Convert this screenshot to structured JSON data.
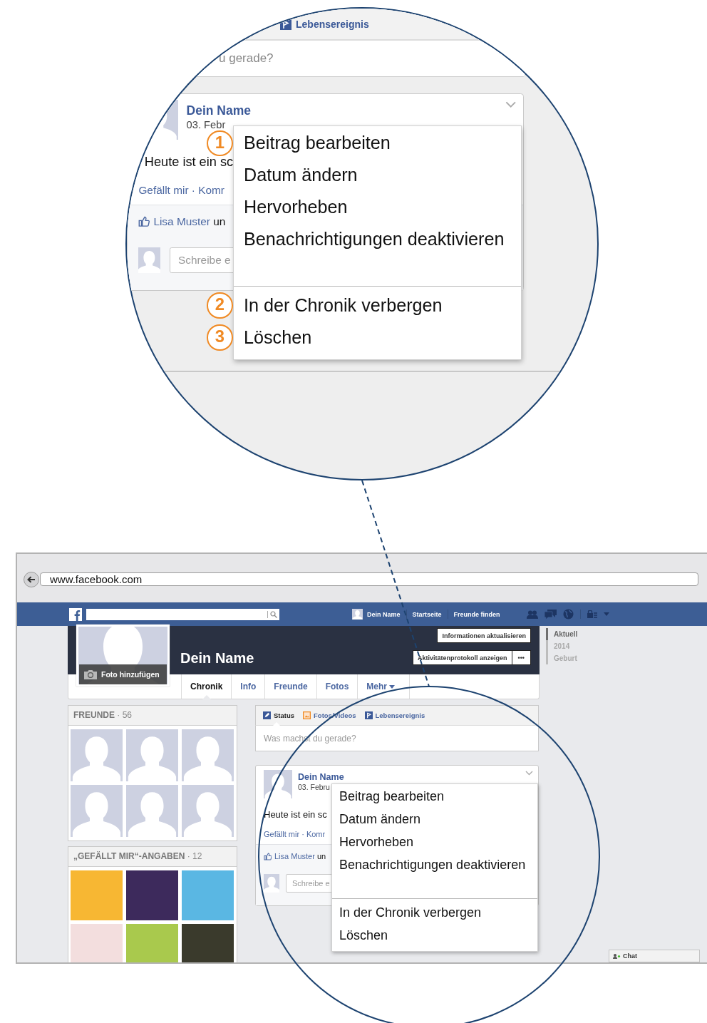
{
  "magnifier": {
    "composer": {
      "tab": "Lebensereignis",
      "placeholder": "u gerade?"
    },
    "post": {
      "author": "Dein Name",
      "date": "03. Febr",
      "text": "Heute ist ein sc",
      "actions": "Gefällt mir · Komr",
      "like_name": "Lisa Muster",
      "like_rest": "un",
      "comment_placeholder": "Schreibe e"
    },
    "menu": {
      "groups": [
        {
          "items": [
            {
              "label": "Beitrag bearbeiten",
              "number": "1"
            },
            {
              "label": "Datum ändern"
            },
            {
              "label": "Hervorheben"
            },
            {
              "label": "Benachrichtigungen deaktivieren"
            }
          ]
        },
        {
          "items": [
            {
              "label": "In der Chronik verbergen",
              "number": "2"
            },
            {
              "label": "Löschen",
              "number": "3"
            }
          ]
        }
      ]
    }
  },
  "browser": {
    "url": "www.facebook.com"
  },
  "topbar": {
    "user": "Dein Name",
    "links": [
      "Startseite",
      "Freunde finden"
    ]
  },
  "profile": {
    "name": "Dein Name",
    "add_photo": "Foto hinzufügen",
    "update_button": "Informationen aktualisieren",
    "activity_button": "Aktivitätenprotokoll anzeigen",
    "more_button": "•••",
    "tabs": [
      {
        "label": "Chronik",
        "selected": true
      },
      {
        "label": "Info",
        "selected": false
      },
      {
        "label": "Freunde",
        "selected": false
      },
      {
        "label": "Fotos",
        "selected": false
      },
      {
        "label": "Mehr",
        "selected": false,
        "dropdown": true
      }
    ]
  },
  "timeline": [
    {
      "label": "Aktuell",
      "selected": true
    },
    {
      "label": "2014",
      "selected": false
    },
    {
      "label": "Geburt",
      "selected": false
    }
  ],
  "friends": {
    "title": "**FREUNDE** · 56"
  },
  "likes": {
    "title": "**„GEFÄLLT MIR“-ANGABEN** · 12"
  },
  "composer": {
    "tabs": [
      {
        "label": "Status",
        "selected": true,
        "kind": "status"
      },
      {
        "label": "Fotos/Videos",
        "selected": false,
        "kind": "photo"
      },
      {
        "label": "Lebensereignis",
        "selected": false,
        "kind": "event"
      }
    ],
    "placeholder": "Was machst du gerade?"
  },
  "post": {
    "author": "Dein Name",
    "date": "03. Febru",
    "text": "Heute ist ein sc",
    "actions": "Gefällt mir · Komr",
    "like_name": "Lisa Muster",
    "like_rest": "un",
    "comment_placeholder": "Schreibe e"
  },
  "menu": {
    "groups": [
      {
        "items": [
          {
            "label": "Beitrag bearbeiten"
          },
          {
            "label": "Datum ändern"
          },
          {
            "label": "Hervorheben"
          },
          {
            "label": "Benachrichtigungen deaktivieren"
          }
        ]
      },
      {
        "items": [
          {
            "label": "In der Chronik verbergen"
          },
          {
            "label": "Löschen"
          }
        ]
      }
    ]
  },
  "chat": {
    "label": "Chat"
  }
}
